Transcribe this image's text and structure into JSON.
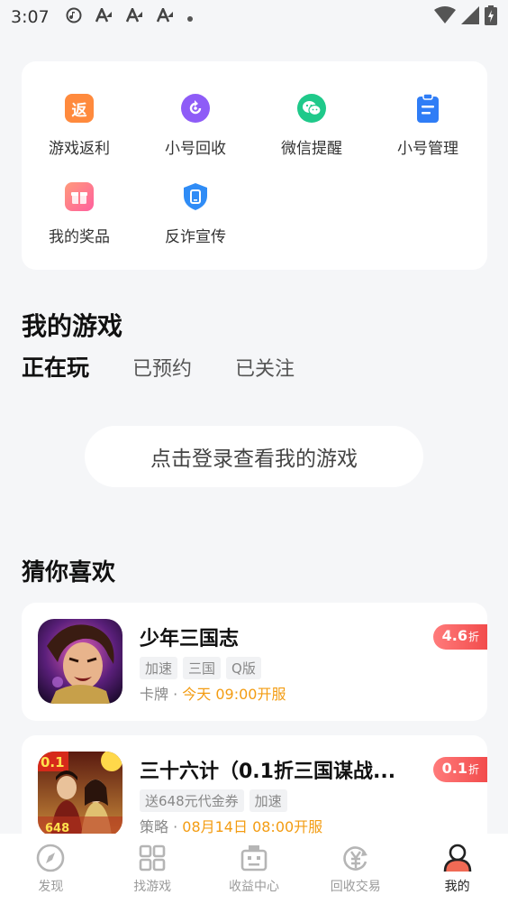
{
  "status_bar": {
    "time": "3:07",
    "notification_icons": [
      "music-icon",
      "a-icon",
      "a-icon",
      "a-icon",
      "dot-icon"
    ],
    "right_icons": [
      "wifi-icon",
      "signal-icon",
      "battery-charging-icon"
    ]
  },
  "shortcuts": [
    {
      "label": "游戏返利",
      "icon": "rebate-icon",
      "glyph": "返",
      "color": "#ff8a3d"
    },
    {
      "label": "小号回收",
      "icon": "recycle-icon",
      "glyph": "",
      "color": "#8e5cf7"
    },
    {
      "label": "微信提醒",
      "icon": "wechat-icon",
      "glyph": "",
      "color": "#1fc98a"
    },
    {
      "label": "小号管理",
      "icon": "clipboard-icon",
      "glyph": "",
      "color": "#2f7df6"
    },
    {
      "label": "我的奖品",
      "icon": "gift-icon",
      "glyph": "",
      "color": "#ff6b8b"
    },
    {
      "label": "反诈宣传",
      "icon": "shield-phone-icon",
      "glyph": "",
      "color": "#2f8cf6"
    }
  ],
  "my_games": {
    "title": "我的游戏",
    "tabs": [
      "正在玩",
      "已预约",
      "已关注"
    ],
    "active_tab": 0,
    "login_prompt": "点击登录查看我的游戏"
  },
  "recommend": {
    "title": "猜你喜欢",
    "games": [
      {
        "name": "少年三国志",
        "tags": [
          "加速",
          "三国",
          "Q版"
        ],
        "category": "卡牌 · ",
        "open_time": "今天 09:00开服",
        "discount": "4.6",
        "discount_unit": "折"
      },
      {
        "name": "三十六计（0.1折三国谋战...",
        "tags": [
          "送648元代金券",
          "加速"
        ],
        "category": "策略 · ",
        "open_time": "08月14日 08:00开服",
        "discount": "0.1",
        "discount_unit": "折"
      }
    ]
  },
  "tabbar": [
    {
      "label": "发现",
      "icon": "compass-icon"
    },
    {
      "label": "找游戏",
      "icon": "grid-icon"
    },
    {
      "label": "收益中心",
      "icon": "robot-icon"
    },
    {
      "label": "回收交易",
      "icon": "yuan-recycle-icon"
    },
    {
      "label": "我的",
      "icon": "user-icon"
    }
  ],
  "active_tab_index": 4,
  "colors": {
    "accent_orange": "#f39c12",
    "discount_red": "#f24c4c",
    "background": "#f5f6f8"
  }
}
